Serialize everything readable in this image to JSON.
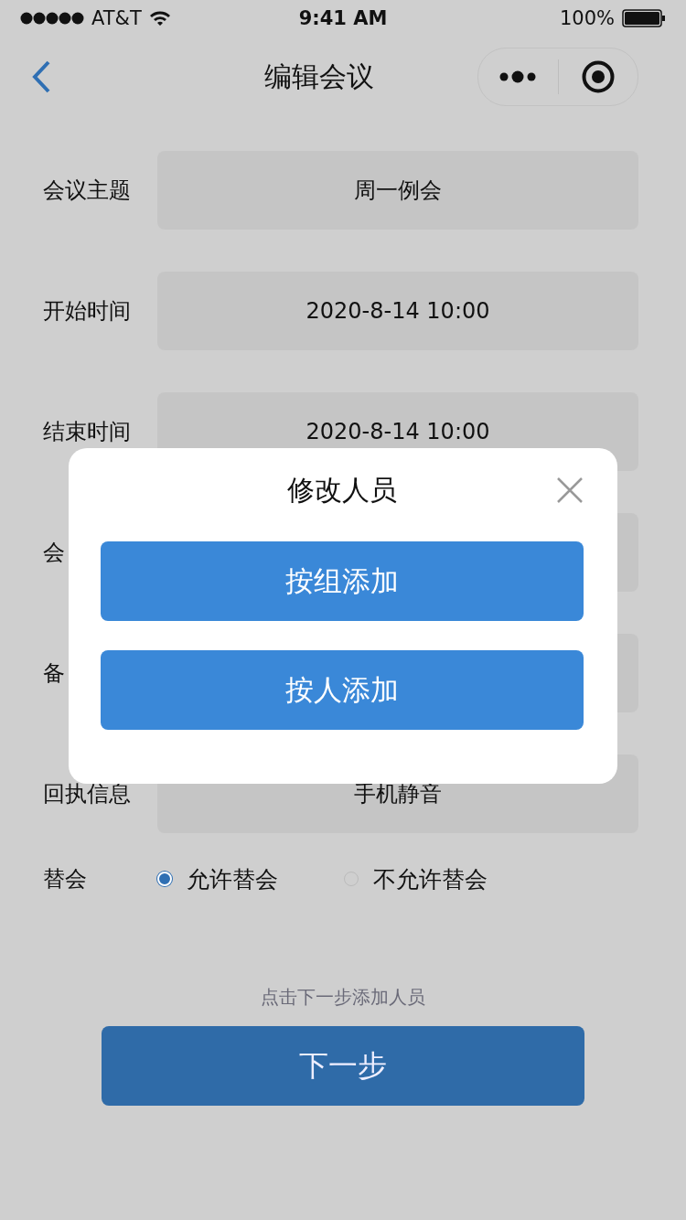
{
  "status_bar": {
    "carrier": "AT&T",
    "time": "9:41 AM",
    "battery": "100%"
  },
  "nav": {
    "title": "编辑会议"
  },
  "form": {
    "fields": [
      {
        "label": "会议主题",
        "value": "周一例会"
      },
      {
        "label": "开始时间",
        "value": "2020-8-14 10:00"
      },
      {
        "label": "结束时间",
        "value": "2020-8-14 10:00"
      },
      {
        "label": "会"
      },
      {
        "label": "备"
      },
      {
        "label": "回执信息",
        "value": "手机静音"
      }
    ]
  },
  "substitute": {
    "label": "替会",
    "options": [
      {
        "label": "允许替会",
        "selected": true
      },
      {
        "label": "不允许替会",
        "selected": false
      }
    ]
  },
  "hint": "点击下一步添加人员",
  "next_button": "下一步",
  "dialog": {
    "title": "修改人员",
    "buttons": [
      "按组添加",
      "按人添加"
    ]
  }
}
